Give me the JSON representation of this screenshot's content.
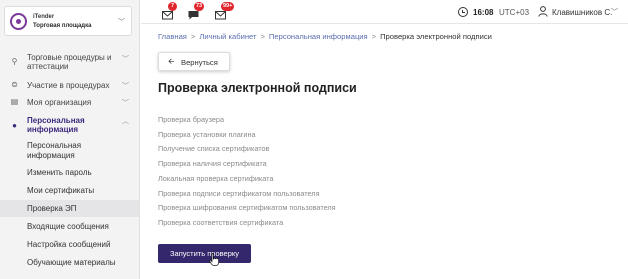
{
  "brand": {
    "name": "iTender",
    "subtitle": "Торговая площадка"
  },
  "sidebar": {
    "items": [
      {
        "label": "Торговые процедуры и аттестации",
        "icon": "award-icon"
      },
      {
        "label": "Участие в процедурах",
        "icon": "handshake-icon"
      },
      {
        "label": "Моя организация",
        "icon": "building-icon"
      },
      {
        "label": "Персональная информация",
        "icon": "person-icon"
      }
    ],
    "subitems": [
      {
        "label": "Персональная информация"
      },
      {
        "label": "Изменить пароль"
      },
      {
        "label": "Мои сертификаты"
      },
      {
        "label": "Проверка ЭП"
      },
      {
        "label": "Входящие сообщения"
      },
      {
        "label": "Настройка сообщений"
      },
      {
        "label": "Обучающие материалы"
      }
    ]
  },
  "topbar": {
    "badges": [
      "7",
      "73",
      "99+"
    ],
    "time": "16:08",
    "timezone": "UTC+03",
    "user": "Клавишников С."
  },
  "breadcrumb": [
    "Главная",
    "Личный кабинет",
    "Персональная информация",
    "Проверка электронной подписи"
  ],
  "back_label": "Вернуться",
  "page_title": "Проверка электронной подписи",
  "checks": [
    "Проверка браузера",
    "Проверка установки плагина",
    "Получение списка сертификатов",
    "Проверка наличия сертификата",
    "Локальная проверка сертификата",
    "Проверка подписи сертификатом пользователя",
    "Проверка шифрования сертификатом пользователя",
    "Проверка соответствия сертификата"
  ],
  "run_label": "Запустить проверку",
  "colors": {
    "primary": "#35276b",
    "badge": "#e0262e",
    "link": "#5b6fb0",
    "sidebar_bg": "#f3f3f4"
  }
}
